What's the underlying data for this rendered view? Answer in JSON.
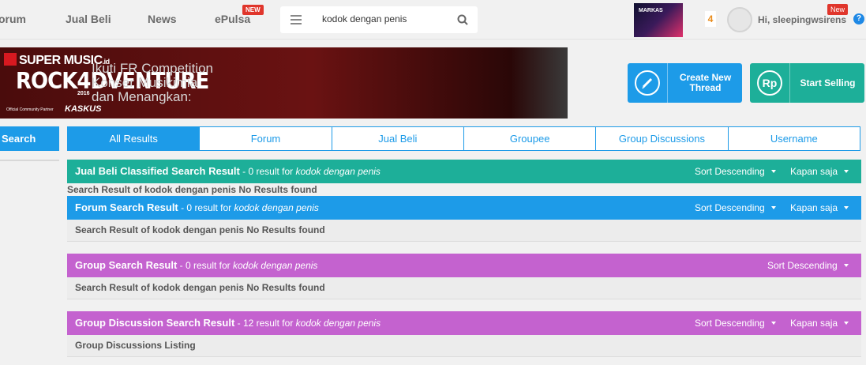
{
  "nav": {
    "items": [
      "orum",
      "Jual Beli",
      "News",
      "ePulsa"
    ],
    "epulsa_badge": "NEW",
    "search_value": "kodok dengan penis",
    "thumb_text": "MARKAS",
    "notif_count": "4",
    "greeting": "Hi, sleepingwsirens",
    "new_badge": "New",
    "help": "?"
  },
  "banner": {
    "logo": "SUPER MUSIC",
    "logo_suffix": ".id",
    "event": "ROCK4DVENTURE",
    "year": "2016",
    "partner": "Official Community Partner",
    "kaskus": "KASKUS",
    "lines": [
      "Ikuti FR Competition",
      "Konser Musikimia",
      "dan Menangkan:"
    ]
  },
  "actions": {
    "create_label": "Create New Thread",
    "sell_label": "Start Selling",
    "sell_icon": "Rp"
  },
  "sidebar": {
    "search_label": "Search"
  },
  "tabs": [
    "All Results",
    "Forum",
    "Jual Beli",
    "Groupee",
    "Group Discussions",
    "Username"
  ],
  "query": "kodok dengan penis",
  "sections": {
    "jualbeli": {
      "title": "Jual Beli Classified Search Result",
      "count": " - 0 result for ",
      "sort": "Sort Descending",
      "time": "Kapan saja",
      "body": "Search Result of kodok dengan penis No Results found",
      "color": "#1daf99"
    },
    "forum": {
      "title": "Forum Search Result",
      "count": " - 0 result for ",
      "sort": "Sort Descending",
      "time": "Kapan saja",
      "body": "Search Result of kodok dengan penis No Results found",
      "color": "#1d9be8"
    },
    "group": {
      "title": "Group Search Result",
      "count": " - 0 result for ",
      "sort": "Sort Descending",
      "body": "Search Result of kodok dengan penis No Results found",
      "color": "#c462cf"
    },
    "groupdisc": {
      "title": "Group Discussion Search Result",
      "count": " - 12 result for ",
      "sort": "Sort Descending",
      "time": "Kapan saja",
      "body": "Group Discussions Listing",
      "color": "#c462cf"
    }
  }
}
